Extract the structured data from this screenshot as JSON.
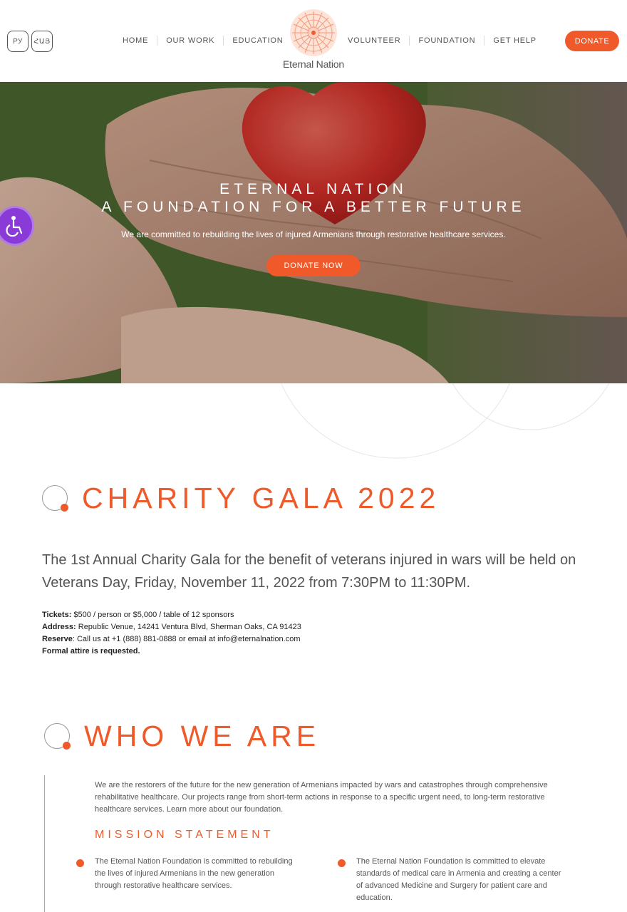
{
  "header": {
    "lang_ru": "РУ",
    "lang_hy": "ՀԱՅ",
    "nav_left": [
      "HOME",
      "OUR WORK",
      "EDUCATION"
    ],
    "nav_right": [
      "VOLUNTEER",
      "FOUNDATION",
      "GET HELP"
    ],
    "logo_text": "Eternal Nation",
    "donate_label": "DONATE"
  },
  "hero": {
    "title_line1": "ETERNAL NATION",
    "title_line2": "A FOUNDATION FOR A BETTER FUTURE",
    "subtitle": "We are committed to rebuilding the lives of injured Armenians through restorative healthcare services.",
    "button_label": "DONATE NOW"
  },
  "gala": {
    "title": "CHARITY GALA 2022",
    "lead": "The 1st Annual Charity Gala for the benefit of veterans injured in wars will be held on Veterans Day, Friday, November 11, 2022 from 7:30PM to 11:30PM.",
    "tickets_label": "Tickets:",
    "tickets_value": " $500 / person or $5,000 / table of 12 sponsors",
    "address_label": "Address:",
    "address_value": " Republic Venue, 14241 Ventura Blvd, Sherman Oaks, CA 91423",
    "reserve_label": "Reserve",
    "reserve_value": ": Call us at +1 (888) 881-0888 or email at info@eternalnation.com",
    "attire": "Formal attire is requested."
  },
  "who": {
    "title": "WHO WE ARE",
    "text": "We are the restorers of the future for the new generation of Armenians impacted by wars and catastrophes through comprehensive rehabilitative healthcare. Our projects range from short-term actions in response to a specific urgent need, to long-term restorative healthcare services. Learn more about our foundation.",
    "mission_title": "MISSION STATEMENT",
    "mission_1": "The Eternal Nation Foundation is committed to rebuilding the lives of injured Armenians in the new generation through restorative healthcare services.",
    "mission_2": "The Eternal Nation Foundation is committed to elevate standards of medical care in Armenia and creating a center of advanced Medicine and Surgery for patient care and education."
  },
  "colors": {
    "accent": "#ef5a2a",
    "accessibility": "#8a3ad6"
  },
  "icons": {
    "logo": "mandala-logo-icon",
    "accessibility": "wheelchair-icon",
    "section": "ring-dot-icon"
  }
}
